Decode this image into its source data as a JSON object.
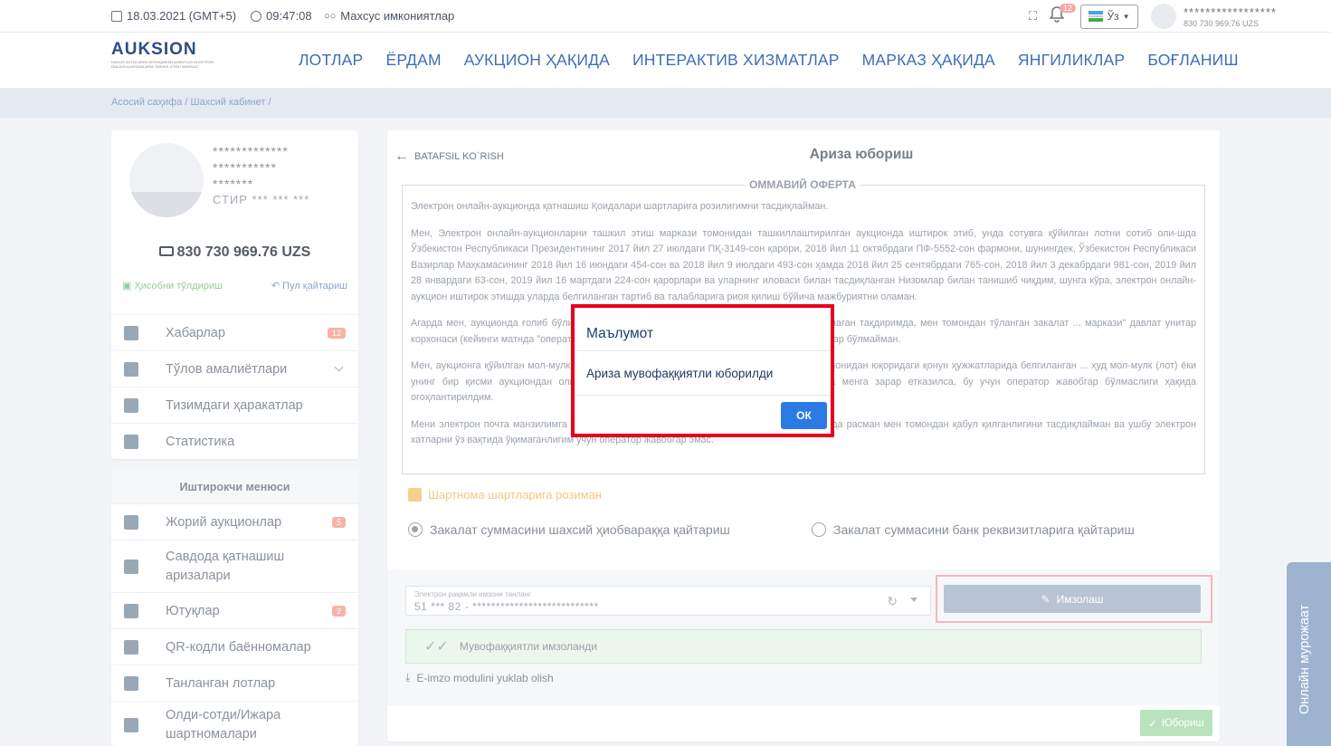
{
  "topbar": {
    "date": "18.03.2021 (GMT+5)",
    "time": "09:47:08",
    "special": "Махсус имкониятлар",
    "notif_count": "12",
    "lang": "Ўз",
    "user_name": "*****************",
    "user_balance": "830 730 969.76 UZS"
  },
  "nav": {
    "logo": "AUKSION",
    "logo_sub": "DAVLAT AKTIVLARINI BOSHQARISH AGENTLIGI ELEKTRON ONLAYN AUKSIONLARNI TASHKIL ETISH MARKAZI",
    "items": [
      "ЛОТЛАР",
      "ЁРДАМ",
      "АУКЦИОН ҲАҚИДА",
      "ИНТЕРАКТИВ ХИЗМАТЛАР",
      "МАРКАЗ ҲАҚИДА",
      "ЯНГИЛИКЛАР",
      "БОҒЛАНИШ"
    ]
  },
  "breadcrumb": "Асосий саҳифа  /  Шахсий кабинет  /",
  "profile": {
    "line1": "*************",
    "line2": "***********",
    "line3": "*******",
    "stir": "СТИР  ***  ***  ***",
    "balance": "830 730 969.76 UZS",
    "topup": "Ҳисобни тўлдириш",
    "refund": "Пул қайтариш",
    "menu": [
      {
        "label": "Хабарлар",
        "badge": "12"
      },
      {
        "label": "Тўлов амалиётлари",
        "badge": ""
      },
      {
        "label": "Тизимдаги ҳаракатлар",
        "badge": ""
      },
      {
        "label": "Статистика",
        "badge": ""
      }
    ]
  },
  "menu2": {
    "title": "Иштирокчи менюси",
    "items": [
      {
        "label": "Жорий аукционлар",
        "badge": "5"
      },
      {
        "label": "Савдода қатнашиш аризалари",
        "badge": ""
      },
      {
        "label": "Ютуқлар",
        "badge": "2"
      },
      {
        "label": "QR-кодли баённомалар",
        "badge": ""
      },
      {
        "label": "Танланган лотлар",
        "badge": ""
      },
      {
        "label": "Олди-сотди/Ижара шартномалари",
        "badge": ""
      }
    ]
  },
  "main": {
    "back": "BATAFSIL KO`RISH",
    "title": "Ариза юбориш",
    "oferta_title": "ОММАВИЙ ОФЕРТА",
    "paragraphs": [
      "Электрон онлайн-аукционда қатнашиш Қоидалари шартларига розилигимни тасдиқлайман.",
      "Мен, Электрон онлайн-аукционларни ташкил этиш маркази томонидан ташкиллаштирилган аукционда иштирок этиб, унда сотувга қўйилган лотни сотиб оли-шда Ўзбекистон Республикаси Президентининг 2017 йил 27 июлдаги ПҚ-3149-сон қарори, 2018 йил 11 октябрдаги ПФ-5552-сон фармони, шунингдек, Ўзбекистон Республикаси Вазирлар Маҳкамасининг 2018 йил 16 июндаги 454-сон ва 2018 йил 9 июлдаги 493-сон ҳамда 2018 йил 25 сентябрдаги 765-сон, 2018 йил 3 декабрдаги 981-сон, 2019 йил 28 январдаги 63-сон, 2019 йил 16 мартдаги 224-сон қарорлари ва уларнинг иловаси билан тасдиқланган Низомлар билан танишиб чиқдим, шунга кўра, электрон онлайн-аукцион иштирок этишда уларда белгиланган тартиб ва талабларига риоя қилиш бўйича мажбуриятни оламан.",
      "Агарда мен, аукционда ғолиб бўлиб, ... учун белгиланган мол-мулк қийматини тўлиқ тўламаган тақдиримда, мен томондан тўланган закалат ... маркази\" давлат унитар корхонаси (кейинги матнда \"оператор\" деб юритилади) ихтиёрида қолишига қарши ... даъвогар бўлмайман.",
      "Мен, аукционга қўйилган мол-мулк ... лиги ҳақида хабардорман, шунга кўра, буюртмачи томонидан юқоридаги қонун ҳужжатларида белгиланган ... ҳуд мол-мулк (лот) ёки унинг бир қисми аукциондан олинса, шунингдек буюртмачи буюртмасига кўрсат... ича менга зарар етказилса, бу учун оператор жавобгар бўлмаслиги ҳақида огоҳлантирилдим.",
      "Мени электрон почта манзилимга оператор томонидан юборилган хатлар, юборилган вақтда расман мен томондан қабул қилганлигини тасдиқлайман ва ушбу электрон хатларни ўз вақтида ўқимаганлигим учун оператор жавобгар эмас."
    ],
    "agree": "Шартнома шартларига розиман",
    "radio1": "Закалат суммасини шахсий ҳиобвараққа қайтариш",
    "radio2": "Закалат суммасини банк реквизитларига қайтариш",
    "select_label": "Электрон рақамли имзони танланг",
    "select_value": "51 *** 82 -   ***************************",
    "sign_button": "Имзолаш",
    "success": "Мувофаққиятли имзоланди",
    "eimzo": "E-imzo modulini yuklab olish",
    "send": "Юбориш"
  },
  "chat_tab": "Онлайн мурожаат",
  "modal": {
    "title": "Маълумот",
    "body": "Ариза мувофаққиятли юборилди",
    "ok": "ОК"
  }
}
